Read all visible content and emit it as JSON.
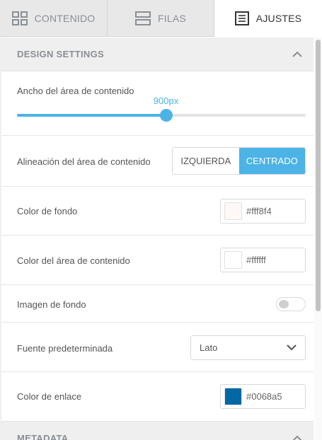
{
  "tabs": [
    {
      "label": "CONTENIDO",
      "icon": "grid-icon"
    },
    {
      "label": "FILAS",
      "icon": "rows-icon"
    },
    {
      "label": "AJUSTES",
      "icon": "settings-page-icon"
    }
  ],
  "design_settings": {
    "title": "DESIGN SETTINGS",
    "content_width": {
      "label": "Ancho del área de contenido",
      "value": "900px",
      "fraction": 0.516
    },
    "alignment": {
      "label": "Alineación del área de contenido",
      "options": [
        "IZQUIERDA",
        "CENTRADO"
      ],
      "selected": "CENTRADO"
    },
    "background_color": {
      "label": "Color de fondo",
      "value": "#fff8f4"
    },
    "content_bg_color": {
      "label": "Color del área de contenido",
      "value": "#ffffff"
    },
    "background_image": {
      "label": "Imagen de fondo",
      "enabled": false
    },
    "default_font": {
      "label": "Fuente predeterminada",
      "value": "Lato"
    },
    "link_color": {
      "label": "Color de enlace",
      "value": "#0068a5"
    }
  },
  "metadata": {
    "title": "METADATA"
  },
  "colors": {
    "accent": "#4cb3e6",
    "tab_bg": "#e8e8e8"
  }
}
